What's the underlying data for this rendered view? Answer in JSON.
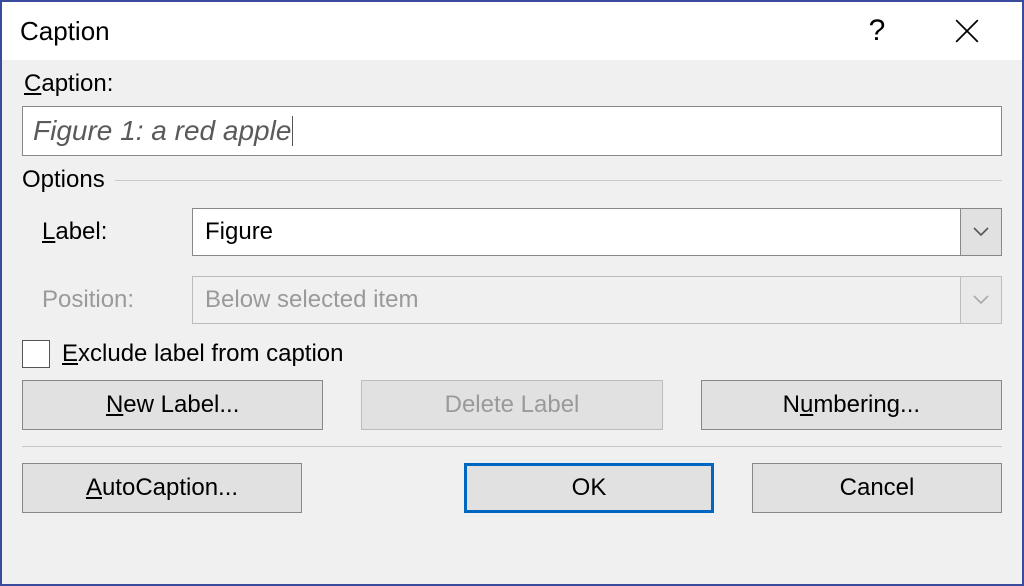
{
  "titlebar": {
    "title": "Caption",
    "help_glyph": "?",
    "close_label": "Close"
  },
  "caption_section": {
    "label": "Caption:",
    "value": "Figure 1: a red apple"
  },
  "options": {
    "title": "Options",
    "label_row": {
      "label": "Label:",
      "value": "Figure"
    },
    "position_row": {
      "label": "Position:",
      "value": "Below selected item"
    }
  },
  "exclude": {
    "label_pre": "",
    "label": "Exclude label from caption",
    "checked": false
  },
  "buttons": {
    "new_label": "New Label...",
    "delete_label": "Delete Label",
    "numbering": "Numbering...",
    "autocaption": "AutoCaption...",
    "ok": "OK",
    "cancel": "Cancel"
  }
}
